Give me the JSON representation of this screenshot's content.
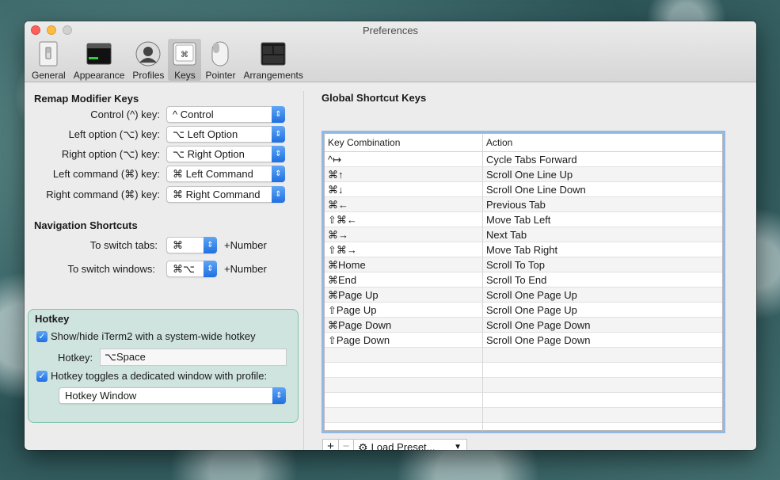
{
  "window": {
    "title": "Preferences"
  },
  "toolbar": {
    "items": [
      {
        "label": "General",
        "icon": "switch-icon"
      },
      {
        "label": "Appearance",
        "icon": "window-icon"
      },
      {
        "label": "Profiles",
        "icon": "person-icon"
      },
      {
        "label": "Keys",
        "icon": "keyboard-key-icon",
        "selected": true
      },
      {
        "label": "Pointer",
        "icon": "mouse-icon"
      },
      {
        "label": "Arrangements",
        "icon": "window-stack-icon"
      }
    ]
  },
  "remap": {
    "title": "Remap Modifier Keys",
    "rows": [
      {
        "label": "Control (^) key:",
        "value": "^ Control"
      },
      {
        "label": "Left option (⌥) key:",
        "value": "⌥ Left Option"
      },
      {
        "label": "Right option (⌥) key:",
        "value": "⌥ Right Option"
      },
      {
        "label": "Left command (⌘) key:",
        "value": "⌘ Left Command"
      },
      {
        "label": "Right command (⌘) key:",
        "value": "⌘ Right Command"
      }
    ]
  },
  "navigation": {
    "title": "Navigation Shortcuts",
    "switch_tabs_label": "To switch tabs:",
    "switch_tabs_value": "⌘",
    "switch_windows_label": "To switch windows:",
    "switch_windows_value": "⌘⌥",
    "suffix": "+Number"
  },
  "hotkey": {
    "title": "Hotkey",
    "show_hide_label": "Show/hide iTerm2 with a system-wide hotkey",
    "show_hide_checked": true,
    "hotkey_label": "Hotkey:",
    "hotkey_value": "⌥Space",
    "dedicated_label": "Hotkey toggles a dedicated window with profile:",
    "dedicated_checked": true,
    "profile_value": "Hotkey Window"
  },
  "global_shortcuts": {
    "title": "Global Shortcut Keys",
    "columns": [
      "Key Combination",
      "Action"
    ],
    "rows": [
      [
        "^↦",
        "Cycle Tabs Forward"
      ],
      [
        "⌘↑",
        "Scroll One Line Up"
      ],
      [
        "⌘↓",
        "Scroll One Line Down"
      ],
      [
        "⌘←",
        "Previous Tab"
      ],
      [
        "⇧⌘←",
        "Move Tab Left"
      ],
      [
        "⌘→",
        "Next Tab"
      ],
      [
        "⇧⌘→",
        "Move Tab Right"
      ],
      [
        "⌘Home",
        "Scroll To Top"
      ],
      [
        "⌘End",
        "Scroll To End"
      ],
      [
        "⌘Page Up",
        "Scroll One Page Up"
      ],
      [
        "⇧Page Up",
        "Scroll One Page Up"
      ],
      [
        "⌘Page Down",
        "Scroll One Page Down"
      ],
      [
        "⇧Page Down",
        "Scroll One Page Down"
      ],
      [
        "",
        ""
      ],
      [
        "",
        ""
      ],
      [
        "",
        ""
      ],
      [
        "",
        ""
      ],
      [
        "",
        ""
      ],
      [
        "",
        ""
      ]
    ],
    "add_label": "+",
    "remove_label": "−",
    "preset_label": "Load Preset..."
  },
  "colors": {
    "accent": "#1f6fe0",
    "hotkey_bg": "#cfe3df",
    "hotkey_border": "#7fc3a9"
  }
}
